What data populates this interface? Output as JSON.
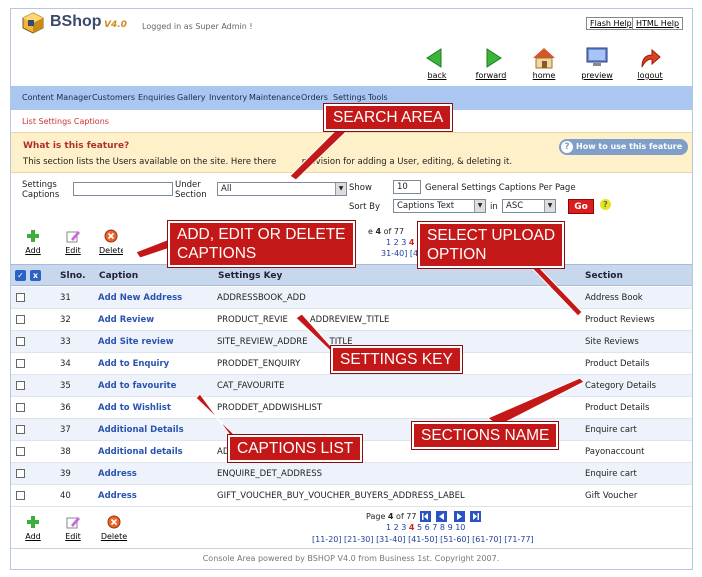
{
  "app": {
    "name": "BShop",
    "version": "V4.0",
    "logged_in": "Logged in as Super Admin !"
  },
  "help_links": [
    "Flash Help",
    "HTML Help"
  ],
  "top_nav": [
    "back",
    "forward",
    "home",
    "preview",
    "logout"
  ],
  "menu": [
    "Content Manager",
    "Customers",
    "Enquiries",
    "Gallery",
    "Inventory",
    "Maintenance",
    "Orders",
    "Settings",
    "Tools"
  ],
  "breadcrumb": "List Settings Captions",
  "feature": {
    "title": "What is this feature?",
    "text": "This section lists the Users available on the site. Here there",
    "text_tail": "provision for adding a User, editing, & deleting it.",
    "howto": "How to use this feature"
  },
  "search": {
    "settings_label_1": "Settings",
    "settings_label_2": "Captions",
    "settings_value": "",
    "under_label_1": "Under",
    "under_label_2": "Section",
    "under_value": "All",
    "show_label": "Show",
    "show_value": "10",
    "per_page_label": "General Settings Captions Per Page",
    "sort_label": "Sort By",
    "sort_value": "Captions Text",
    "in_label": "in",
    "order_value": "ASC",
    "go_label": "Go",
    "help_mark": "?"
  },
  "actions": {
    "add": "Add",
    "edit": "Edit",
    "delete": "Delete"
  },
  "pager_top": {
    "prefix": "e",
    "page": "4",
    "of_text": "of 77",
    "nums": [
      "1",
      "2",
      "3",
      "4"
    ],
    "ranges_fragment": "31-40] [4"
  },
  "table": {
    "headers": {
      "slno": "Slno.",
      "caption": "Caption",
      "key": "Settings Key",
      "section": "Section"
    },
    "rows": [
      {
        "slno": "31",
        "caption": "Add New Address",
        "key": "ADDRESSBOOK_ADD",
        "section": "Address Book"
      },
      {
        "slno": "32",
        "caption": "Add Review",
        "key": "PRODUCT_REVIE",
        "key_tail": "ADDREVIEW_TITLE",
        "section": "Product Reviews"
      },
      {
        "slno": "33",
        "caption": "Add Site review",
        "key": "SITE_REVIEW_ADDRE",
        "key_tail": "TITLE",
        "section": "Site Reviews"
      },
      {
        "slno": "34",
        "caption": "Add to Enquiry",
        "key": "PRODDET_ENQUIRY",
        "section": "Product Details"
      },
      {
        "slno": "35",
        "caption": "Add to favourite",
        "key": "CAT_FAVOURITE",
        "section": "Category Details"
      },
      {
        "slno": "36",
        "caption": "Add to Wishlist",
        "key": "PRODDET_ADDWISHLIST",
        "section": "Product Details"
      },
      {
        "slno": "37",
        "caption": "Additional Details",
        "key": "",
        "section": "Enquire cart"
      },
      {
        "slno": "38",
        "caption": "Additional details",
        "key": "AD",
        "section": "Payonaccount"
      },
      {
        "slno": "39",
        "caption": "Address",
        "key": "ENQUIRE_DET_ADDRESS",
        "section": "Enquire cart"
      },
      {
        "slno": "40",
        "caption": "Address",
        "key": "GIFT_VOUCHER_BUY_VOUCHER_BUYERS_ADDRESS_LABEL",
        "section": "Gift Voucher"
      }
    ]
  },
  "pager_bottom": {
    "page_text": "Page",
    "page": "4",
    "of_text": "of 77",
    "nums_before": "1 2 3",
    "current": "4",
    "nums_after": "5 6 7 8 9 10",
    "ranges": "[11-20] [21-30] [31-40] [41-50] [51-60] [61-70] [71-77]"
  },
  "footer": "Console Area powered by BSHOP V4.0 from Business 1st. Copyright 2007.",
  "callouts": {
    "search": "SEARCH AREA",
    "add_edit_1": "ADD, EDIT OR DELETE",
    "add_edit_2": "CAPTIONS",
    "upload_1": "SELECT UPLOAD",
    "upload_2": "OPTION",
    "settings_key": "SETTINGS KEY",
    "captions_list": "CAPTIONS LIST",
    "sections_name": "SECTIONS NAME"
  },
  "colors": {
    "callout": "#c41818",
    "menubar": "#a9c7f0",
    "feature_bg": "#fef0c8",
    "link": "#2a54b0",
    "go": "#d81e1e"
  }
}
